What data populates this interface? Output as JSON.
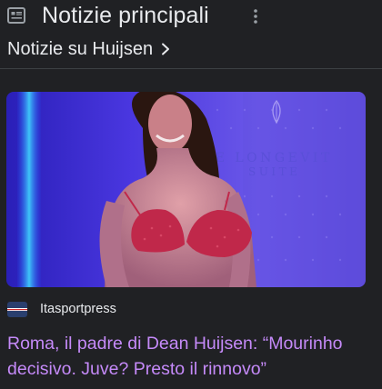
{
  "header": {
    "title": "Notizie principali",
    "icons": [
      "newspaper-icon",
      "more-vert-icon"
    ]
  },
  "topic": {
    "label": "Notizie su Huijsen",
    "icon": "chevron-right-icon"
  },
  "article": {
    "image_text_line1": "HE LONGEVIT",
    "image_text_line2": "SUITE",
    "source": "Itasportpress",
    "source_logo_colors": [
      "#2a3f6e",
      "#ffffff",
      "#d12a2a"
    ],
    "headline": "Roma, il padre di Dean Huijsen: “Mourinho decisivo. Juve? Presto il rinnovo”"
  },
  "colors": {
    "background": "#202124",
    "text": "#e8eaed",
    "headline": "#c58af9"
  }
}
